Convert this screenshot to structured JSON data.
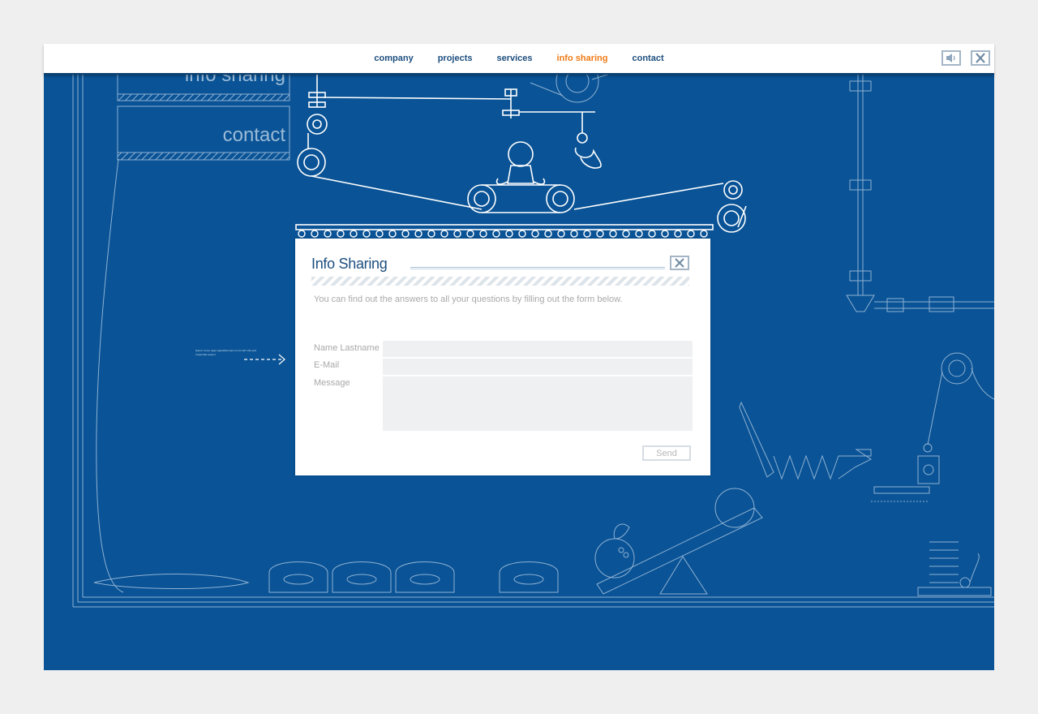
{
  "nav": {
    "items": [
      {
        "label": "company",
        "active": false
      },
      {
        "label": "projects",
        "active": false
      },
      {
        "label": "services",
        "active": false
      },
      {
        "label": "info sharing",
        "active": true
      },
      {
        "label": "contact",
        "active": false
      }
    ],
    "active_color": "#f07b17",
    "link_color": "#1d4e7f"
  },
  "toolbar": {
    "sound_icon": "speaker-icon",
    "close_icon": "close-icon"
  },
  "background": {
    "color": "#095396",
    "menu_labels": [
      "info sharing",
      "contact"
    ]
  },
  "hint": {
    "text": "Ipsum ecivo agis Ligulafest peccorum elit vita sed imperdiet assecl"
  },
  "modal": {
    "title": "Info Sharing",
    "intro": "You can find out the answers to all your questions by filling out the form below.",
    "fields": {
      "name_label": "Name Lastname",
      "email_label": "E-Mail",
      "message_label": "Message"
    },
    "send_label": "Send",
    "close_icon": "close-icon"
  }
}
